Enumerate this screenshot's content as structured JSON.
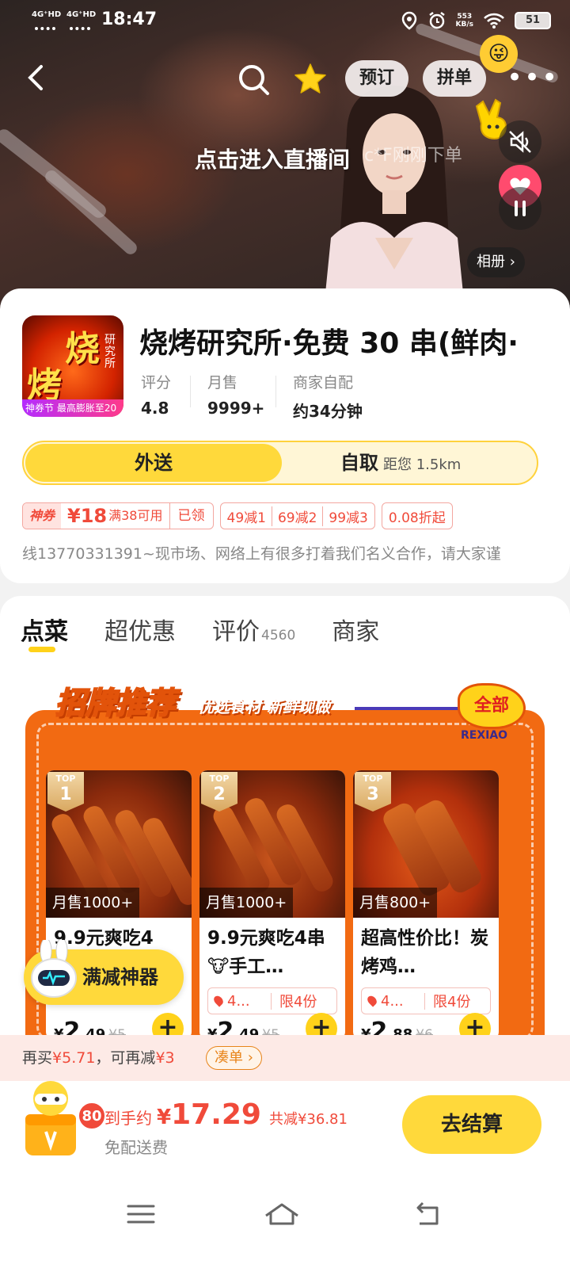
{
  "status_bar": {
    "net1": "4G⁺HD",
    "net2": "4G⁺HD",
    "time": "18:47",
    "speed_top": "553",
    "speed_unit": "KB/s",
    "battery": "51"
  },
  "header": {
    "book_label": "预订",
    "group_label": "拼单",
    "more_label": "•••"
  },
  "video": {
    "live_text": "点击进入直播间",
    "ticker": "c*F刚刚下单",
    "album_label": "相册 ›"
  },
  "store": {
    "logo_text_1": "烧",
    "logo_text_2": "烤",
    "logo_side": "研究所",
    "logo_banner": "神券节 最高膨胀至20",
    "name": "烧烤研究所·免费 30 串(鲜肉·",
    "stats": [
      {
        "label": "评分",
        "value": "4.8"
      },
      {
        "label": "月售",
        "value": "9999+"
      },
      {
        "label": "商家自配",
        "value": "约34分钟"
      }
    ],
    "delivery_label": "外送",
    "pickup_label": "自取",
    "distance": "距您 1.5km",
    "coupon": {
      "tag": "神券",
      "value": "¥18",
      "cond": "满38可用",
      "got": "已领"
    },
    "discounts": [
      "49减1",
      "69减2",
      "99减3"
    ],
    "discount_rate": "0.08折起",
    "notice": "线13770331391~现市场、网络上有很多打着我们名义合作，请大家谨"
  },
  "tabs": [
    {
      "label": "点菜",
      "count": ""
    },
    {
      "label": "超优惠",
      "count": ""
    },
    {
      "label": "评价",
      "count": "4560"
    },
    {
      "label": "商家",
      "count": ""
    }
  ],
  "promo": {
    "title": "招牌推荐",
    "subtitle": "优选食材 新鲜现做",
    "all_label": "全部",
    "all_en": "REXIAO",
    "products": [
      {
        "rank": "1",
        "top": "TOP",
        "sold": "月售1000+",
        "name": "9.9元爽吃4",
        "price_sym": "¥",
        "price": "2",
        "price_dec": ".49",
        "orig": "¥5",
        "tag_a": "",
        "tag_b": ""
      },
      {
        "rank": "2",
        "top": "TOP",
        "sold": "月售1000+",
        "name": "9.9元爽吃4串🐮手工…",
        "price_sym": "¥",
        "price": "2",
        "price_dec": ".49",
        "orig": "¥5",
        "tag_a": "4...",
        "tag_b": "限4份"
      },
      {
        "rank": "3",
        "top": "TOP",
        "sold": "月售800+",
        "name": "超高性价比！炭烤鸡…",
        "price_sym": "¥",
        "price": "2",
        "price_dec": ".88",
        "orig": "¥6",
        "tag_a": "4...",
        "tag_b": "限4份"
      }
    ],
    "add_label": "+"
  },
  "fab": {
    "label": "满减神器"
  },
  "rebuy": {
    "prefix": "再买",
    "amount": "¥5.71",
    "mid": "，可再减",
    "save": "¥3",
    "button": "凑单 ›"
  },
  "cart": {
    "count": "80",
    "total_label": "到手约",
    "total_sym": "¥",
    "total": "17.29",
    "saved": "共减¥36.81",
    "delivery": "免配送费",
    "checkout": "去结算"
  },
  "colors": {
    "brand_yellow": "#ffd93b",
    "price_red": "#f04a3a",
    "promo_orange": "#f26a12"
  }
}
